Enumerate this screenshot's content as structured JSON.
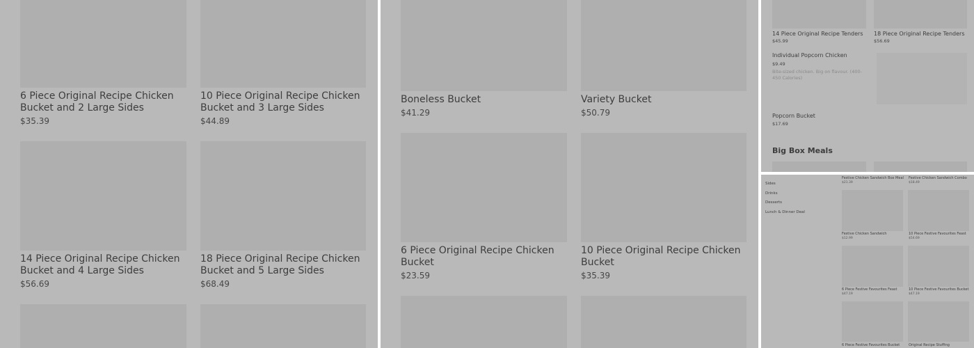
{
  "panel1": {
    "items": [
      {
        "name": "6 Piece Original Recipe Chicken Bucket and 2 Large Sides",
        "price": "$35.39"
      },
      {
        "name": "10 Piece Original Recipe Chicken Bucket and 3 Large Sides",
        "price": "$44.89"
      },
      {
        "name": "14 Piece Original Recipe Chicken Bucket and 4 Large Sides",
        "price": "$56.69"
      },
      {
        "name": "18 Piece Original Recipe Chicken Bucket and 5 Large Sides",
        "price": "$68.49"
      }
    ]
  },
  "panel2": {
    "items": [
      {
        "name": "Boneless Bucket",
        "price": "$41.29"
      },
      {
        "name": "Variety Bucket",
        "price": "$50.79"
      },
      {
        "name": "6 Piece Original Recipe Chicken Bucket",
        "price": "$23.59"
      },
      {
        "name": "10 Piece Original Recipe Chicken Bucket",
        "price": "$35.39"
      }
    ]
  },
  "panel3": {
    "items": [
      {
        "name": "14 Piece Original Recipe Tenders",
        "price": "$45.99"
      },
      {
        "name": "18 Piece Original Recipe Tenders",
        "price": "$56.69"
      },
      {
        "name": "Individual Popcorn Chicken",
        "price": "$9.49",
        "description": "Bite-sized chicken. Big on flavour. (400-450 Calories)"
      },
      {
        "name": "Popcorn Bucket",
        "price": "$17.69"
      }
    ],
    "section_heading": "Big Box Meals"
  },
  "panel4": {
    "nav": [
      "Sides",
      "Drinks",
      "Desserts",
      "Lunch & Dinner Deal"
    ],
    "items": [
      {
        "name": "Festive Chicken Sandwich Box Meal",
        "price": "$21.39"
      },
      {
        "name": "Festive Chicken Sandwich Combo",
        "price": "$18.49"
      },
      {
        "name": "Festive Chicken Sandwich",
        "price": "$12.99"
      },
      {
        "name": "10 Piece Festive Favourites Feast",
        "price": "$54.69"
      },
      {
        "name": "6 Piece Festive Favourites Feast",
        "price": "$47.19"
      },
      {
        "name": "10 Piece Festive Favourites Bucket",
        "price": "$47.19"
      },
      {
        "name": "6 Piece Festive Favourites Bucket",
        "price": ""
      },
      {
        "name": "Original Recipe Stuffing",
        "price": ""
      }
    ]
  }
}
